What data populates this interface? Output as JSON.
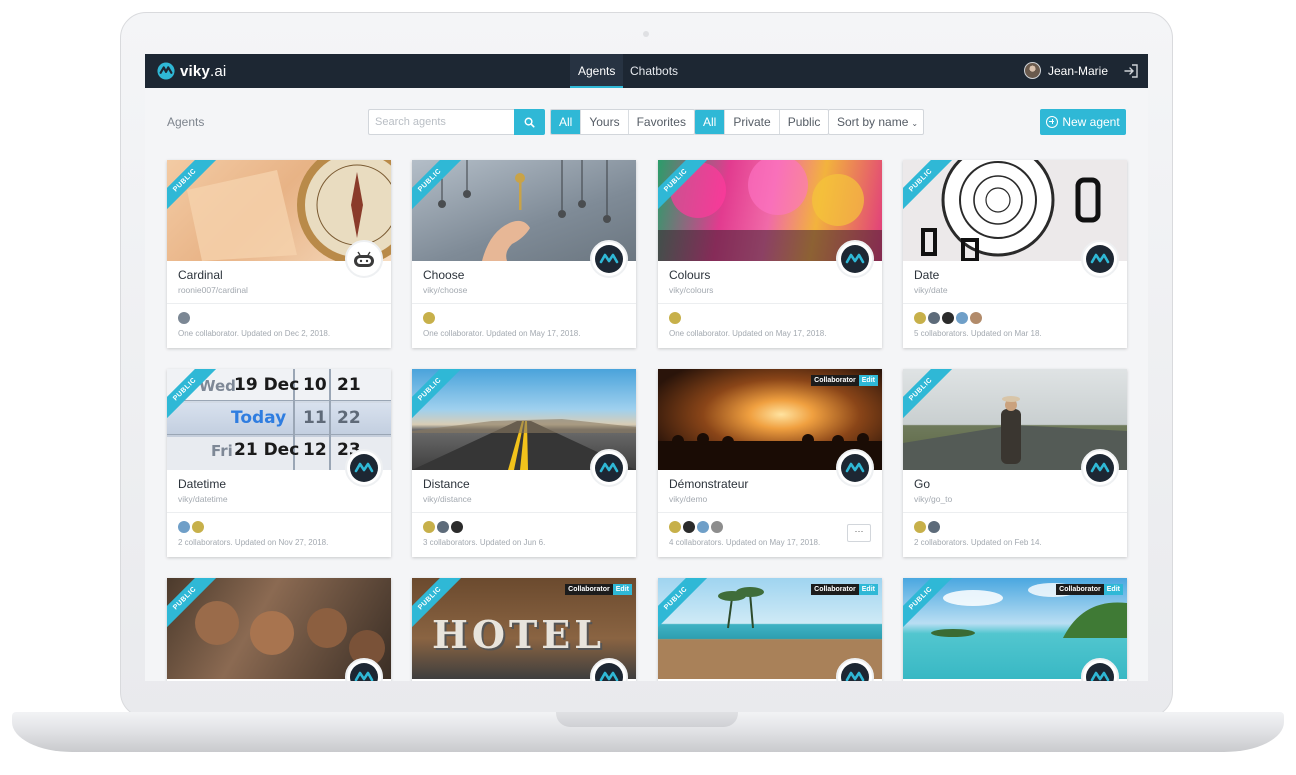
{
  "brand": {
    "name": "viky",
    "suffix": ".ai"
  },
  "nav": {
    "tabs": [
      {
        "label": "Agents",
        "active": true
      },
      {
        "label": "Chatbots",
        "active": false
      }
    ]
  },
  "user": {
    "name": "Jean-Marie"
  },
  "page": {
    "title": "Agents"
  },
  "search": {
    "placeholder": "Search agents"
  },
  "filters": {
    "ownership": [
      {
        "label": "All",
        "active": true
      },
      {
        "label": "Yours",
        "active": false
      },
      {
        "label": "Favorites",
        "active": false
      }
    ],
    "visibility": [
      {
        "label": "All",
        "active": true
      },
      {
        "label": "Private",
        "active": false
      },
      {
        "label": "Public",
        "active": false
      }
    ]
  },
  "sort": {
    "label": "Sort by name"
  },
  "new_agent": {
    "label": "New agent"
  },
  "colors": {
    "accent": "#2fb8d6",
    "navbar": "#1d2733"
  },
  "cards": [
    {
      "name": "Cardinal",
      "slug": "roonie007/cardinal",
      "ribbon": "PUBLIC",
      "meta": "One collaborator. Updated on Dec 2, 2018.",
      "icon": "robot-icon"
    },
    {
      "name": "Choose",
      "slug": "viky/choose",
      "ribbon": "PUBLIC",
      "meta": "One collaborator. Updated on May 17, 2018.",
      "icon": "viky-logo-icon"
    },
    {
      "name": "Colours",
      "slug": "viky/colours",
      "ribbon": "PUBLIC",
      "meta": "One collaborator. Updated on May 17, 2018.",
      "icon": "viky-logo-icon"
    },
    {
      "name": "Date",
      "slug": "viky/date",
      "ribbon": "PUBLIC",
      "meta": "5 collaborators. Updated on Mar 18.",
      "icon": "viky-logo-icon"
    },
    {
      "name": "Datetime",
      "slug": "viky/datetime",
      "ribbon": "PUBLIC",
      "meta": "2 collaborators. Updated on Nov 27, 2018.",
      "icon": "viky-logo-icon",
      "image_text": {
        "row1": [
          "Wed",
          "19 Dec",
          "10",
          "21"
        ],
        "row2": [
          "Today",
          "11",
          "22"
        ],
        "row3": [
          "Fri",
          "21 Dec",
          "12",
          "23"
        ]
      }
    },
    {
      "name": "Distance",
      "slug": "viky/distance",
      "ribbon": "PUBLIC",
      "meta": "3 collaborators. Updated on Jun 6.",
      "icon": "viky-logo-icon"
    },
    {
      "name": "Démonstrateur",
      "slug": "viky/demo",
      "collaborator": "Collaborator",
      "edit": "Edit",
      "meta": "4 collaborators. Updated on May 17, 2018.",
      "icon": "viky-logo-icon",
      "more": "···"
    },
    {
      "name": "Go",
      "slug": "viky/go_to",
      "ribbon": "PUBLIC",
      "meta": "2 collaborators. Updated on Feb 14.",
      "icon": "viky-logo-icon"
    },
    {
      "ribbon": "PUBLIC",
      "icon": "viky-logo-icon"
    },
    {
      "ribbon": "PUBLIC",
      "collaborator": "Collaborator",
      "edit": "Edit",
      "icon": "viky-logo-icon",
      "image_text": "HOTEL"
    },
    {
      "ribbon": "PUBLIC",
      "collaborator": "Collaborator",
      "edit": "Edit",
      "icon": "viky-logo-icon"
    },
    {
      "ribbon": "PUBLIC",
      "collaborator": "Collaborator",
      "edit": "Edit",
      "icon": "viky-logo-icon"
    }
  ]
}
